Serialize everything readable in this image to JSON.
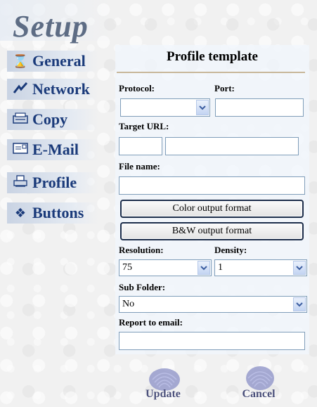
{
  "app": {
    "title": "Setup"
  },
  "sidebar": {
    "items": [
      {
        "label": "General",
        "icon": "hourglass-icon"
      },
      {
        "label": "Network",
        "icon": "network-icon"
      },
      {
        "label": "Copy",
        "icon": "copy-icon"
      },
      {
        "label": "E-Mail",
        "icon": "email-icon"
      },
      {
        "label": "Profile",
        "icon": "printer-icon"
      },
      {
        "label": "Buttons",
        "icon": "buttons-icon"
      }
    ]
  },
  "form": {
    "heading": "Profile template",
    "protocol_label": "Protocol:",
    "protocol_value": "",
    "port_label": "Port:",
    "port_value": "",
    "target_url_label": "Target URL:",
    "target_url_prefix": "",
    "target_url_value": "",
    "file_name_label": "File name:",
    "file_name_value": "",
    "color_button": "Color output format",
    "bw_button": "B&W output format",
    "resolution_label": "Resolution:",
    "resolution_value": "75",
    "density_label": "Density:",
    "density_value": "1",
    "sub_folder_label": "Sub Folder:",
    "sub_folder_value": "No",
    "report_email_label": "Report to email:",
    "report_email_value": ""
  },
  "actions": {
    "update": "Update",
    "cancel": "Cancel"
  },
  "colors": {
    "title": "#5d6c84",
    "nav_text": "#1a3a7a",
    "accent_rule": "#c8b79a",
    "field_border": "#7f9db9"
  }
}
